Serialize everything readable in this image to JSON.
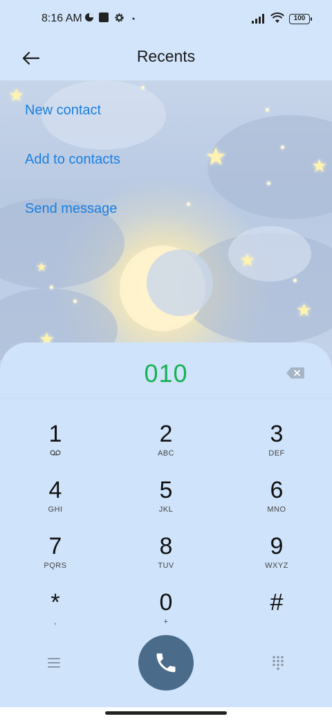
{
  "status_bar": {
    "time": "8:16 AM",
    "battery": "100",
    "icons": [
      "data-saver-icon",
      "square-app-icon",
      "settings-gear-icon",
      "dot-icon",
      "signal-icon",
      "wifi-icon",
      "battery-icon"
    ]
  },
  "header": {
    "title": "Recents",
    "back_icon": "arrow-left-icon"
  },
  "actions": {
    "new_contact": "New contact",
    "add_to_contacts": "Add to contacts",
    "send_message": "Send message"
  },
  "dialer": {
    "number": "010",
    "accent_color": "#17b254",
    "call_button_color": "#4a6b8a",
    "keys": [
      {
        "digit": "1",
        "letters": ""
      },
      {
        "digit": "2",
        "letters": "ABC"
      },
      {
        "digit": "3",
        "letters": "DEF"
      },
      {
        "digit": "4",
        "letters": "GHI"
      },
      {
        "digit": "5",
        "letters": "JKL"
      },
      {
        "digit": "6",
        "letters": "MNO"
      },
      {
        "digit": "7",
        "letters": "PQRS"
      },
      {
        "digit": "8",
        "letters": "TUV"
      },
      {
        "digit": "9",
        "letters": "WXYZ"
      },
      {
        "digit": "*",
        "letters": ","
      },
      {
        "digit": "0",
        "letters": "+"
      },
      {
        "digit": "#",
        "letters": ""
      }
    ]
  }
}
